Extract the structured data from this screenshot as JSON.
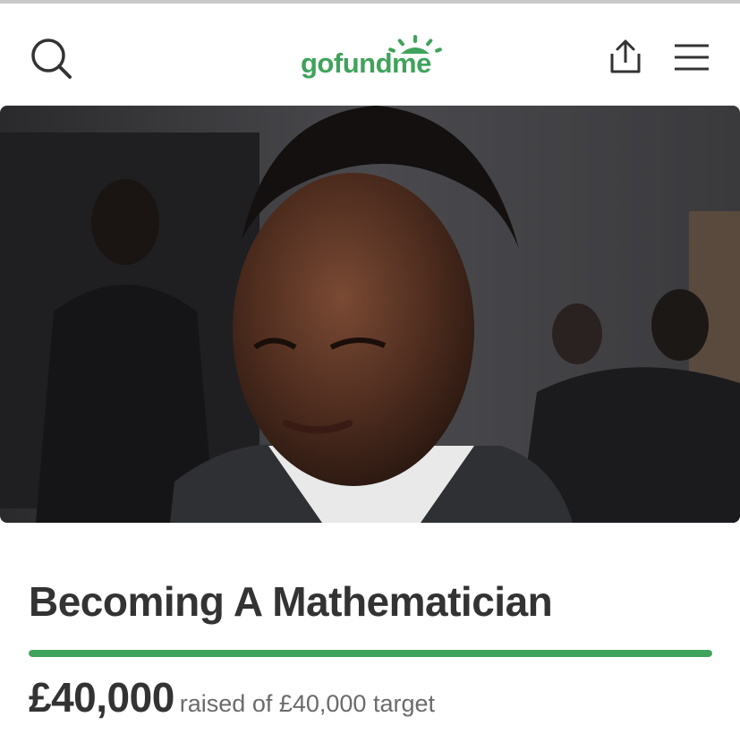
{
  "header": {
    "logo_text": "gofundme",
    "icons": {
      "search": "search-icon",
      "share": "share-icon",
      "menu": "hamburger-menu-icon"
    }
  },
  "hero": {
    "image_subject": "photo"
  },
  "campaign": {
    "title": "Becoming A Mathematician",
    "raised_amount": "£40,000",
    "raised_text": "raised of £40,000 target",
    "progress_fraction": 1.0
  },
  "colors": {
    "brand_green": "#3fa35b",
    "text_dark": "#333333",
    "text_muted": "#6b6b6b"
  }
}
